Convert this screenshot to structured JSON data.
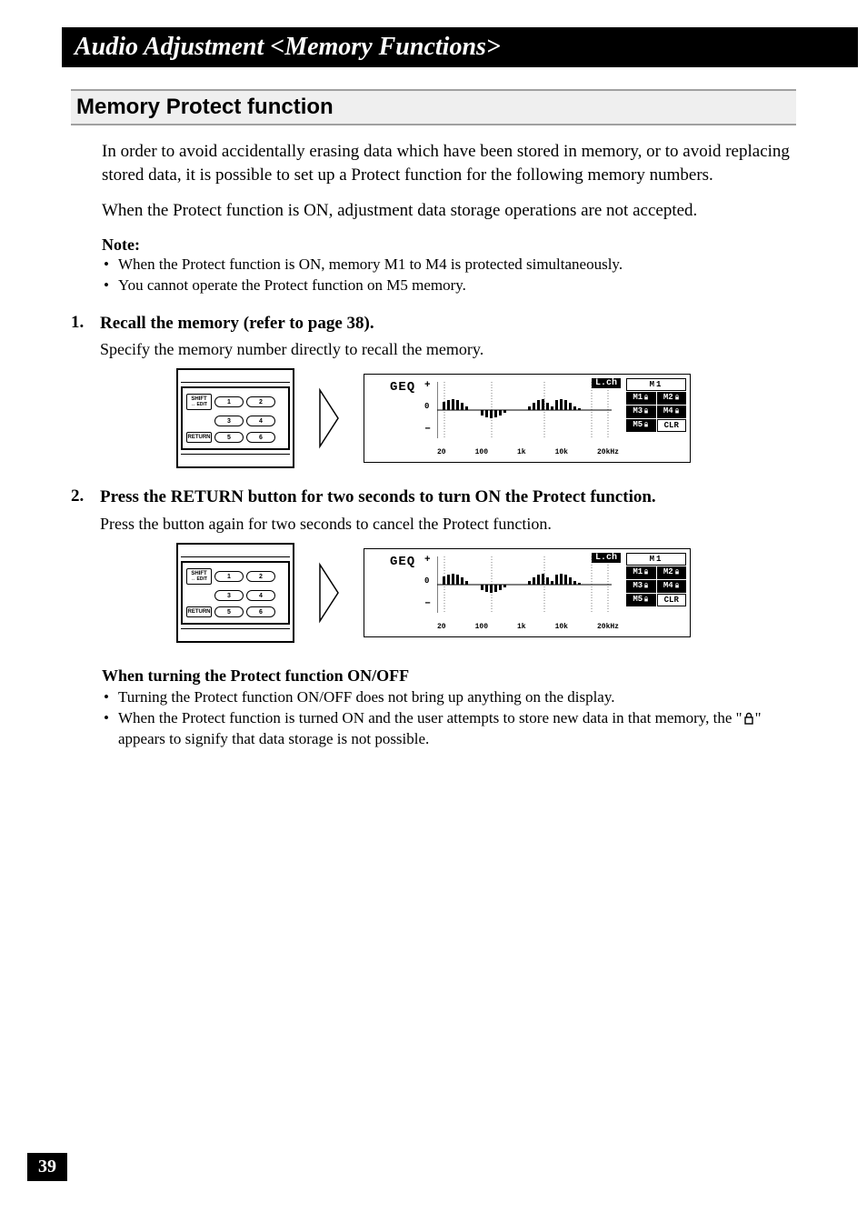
{
  "banner": "Audio Adjustment <Memory Functions>",
  "section_heading": "Memory Protect function",
  "intro_p1": "In order to avoid accidentally erasing data which have been stored in memory, or to avoid replacing stored data, it is possible to set up a Protect function for the following memory numbers.",
  "intro_p2": "When the Protect function is ON, adjustment data storage operations are not accepted.",
  "note": {
    "title": "Note:",
    "items": [
      "When the Protect function is ON, memory M1 to M4 is protected simultaneously.",
      "You cannot operate the Protect function on M5 memory."
    ]
  },
  "step1": {
    "num": "1.",
    "title": "Recall the memory (refer to page 38).",
    "desc": "Specify the memory number directly to recall the memory."
  },
  "step2": {
    "num": "2.",
    "title": "Press the RETURN button for two seconds to turn ON the Protect function.",
    "desc": "Press the button again for two seconds to cancel the Protect function."
  },
  "keypad": {
    "shift": "SHIFT",
    "shift_sub": "↔ EDIT",
    "return": "RETURN",
    "buttons": [
      "1",
      "2",
      "3",
      "4",
      "5",
      "6"
    ]
  },
  "lcd": {
    "geq": "GEQ",
    "lch": "L.ch",
    "xaxis": [
      "20",
      "100",
      "1k",
      "10k",
      "20kHz"
    ],
    "yplus": "+",
    "yzero": "0",
    "yminus": "–",
    "mem_top": "M1",
    "mem_cells": [
      "M1",
      "M2",
      "M3",
      "M4",
      "M5",
      "CLR"
    ]
  },
  "onoff": {
    "title": "When turning the Protect function ON/OFF",
    "item1": "Turning the Protect function ON/OFF does not bring up anything on the display.",
    "item2_pre": "When the Protect function is turned ON and the user attempts to store new data in that memory, the \"",
    "item2_post": "\" appears to signify that data storage is not possible."
  },
  "page_number": "39"
}
